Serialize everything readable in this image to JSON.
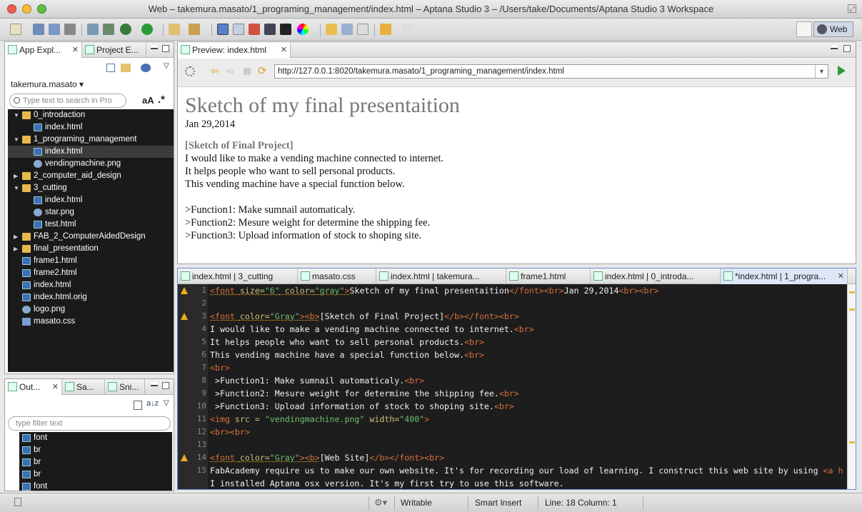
{
  "window": {
    "title": "Web – takemura.masato/1_programing_management/index.html – Aptana Studio 3 – /Users/take/Documents/Aptana Studio 3 Workspace"
  },
  "toolbar": {
    "perspective_label": "Web"
  },
  "explorer": {
    "tabs": [
      {
        "label": "App Expl..."
      },
      {
        "label": "Project E..."
      }
    ],
    "project": "takemura.masato ▾",
    "search_placeholder": "Type text to search in Pro",
    "case_label": "aA",
    "regex_label": ".*",
    "tree": [
      {
        "label": "0_introdaction",
        "kind": "folder",
        "expanded": true
      },
      {
        "label": "index.html",
        "kind": "html"
      },
      {
        "label": "1_programing_management",
        "kind": "folder",
        "expanded": true
      },
      {
        "label": "index.html",
        "kind": "html",
        "selected": true
      },
      {
        "label": "vendingmachine.png",
        "kind": "png"
      },
      {
        "label": "2_computer_aid_design",
        "kind": "folder",
        "expanded": false
      },
      {
        "label": "3_cutting",
        "kind": "folder",
        "expanded": true
      },
      {
        "label": "index.html",
        "kind": "html"
      },
      {
        "label": "star.png",
        "kind": "png"
      },
      {
        "label": "test.html",
        "kind": "html"
      },
      {
        "label": "FAB_2_ComputerAidedDesign",
        "kind": "folder",
        "expanded": false
      },
      {
        "label": "final_presentation",
        "kind": "folder",
        "expanded": false
      },
      {
        "label": "frame1.html",
        "kind": "html"
      },
      {
        "label": "frame2.html",
        "kind": "html"
      },
      {
        "label": "index.html",
        "kind": "html"
      },
      {
        "label": "index.html.orig",
        "kind": "html"
      },
      {
        "label": "logo.png",
        "kind": "png"
      },
      {
        "label": "masato.css",
        "kind": "css"
      }
    ]
  },
  "outline": {
    "tabs": [
      {
        "label": "Out..."
      },
      {
        "label": "Sa..."
      },
      {
        "label": "Sni..."
      }
    ],
    "filter_placeholder": "type filter text",
    "items": [
      "font",
      "br",
      "br",
      "br",
      "font"
    ]
  },
  "preview": {
    "tab_label": "Preview: index.html",
    "url": "http://127.0.0.1:8020/takemura.masato/1_programing_management/index.html",
    "heading": "Sketch of my final presentaition",
    "date": "Jan 29,2014",
    "section_title": "[Sketch of Final Project]",
    "lines": [
      "I would like to make a vending machine connected to internet.",
      "It helps people who want to sell personal products.",
      "This vending machine have a special function below."
    ],
    "functions": [
      ">Function1: Make sumnail automaticaly.",
      ">Function2: Mesure weight for determine the shipping fee.",
      ">Function3: Upload information of stock to shoping site."
    ]
  },
  "editor": {
    "tabs": [
      {
        "label": "index.html | 3_cutting"
      },
      {
        "label": "masato.css"
      },
      {
        "label": "index.html | takemura..."
      },
      {
        "label": "frame1.html"
      },
      {
        "label": "index.html | 0_introda..."
      },
      {
        "label": "*index.html | 1_progra..."
      }
    ],
    "line_numbers": [
      "1",
      "2",
      "3",
      "4",
      "5",
      "6",
      "7",
      "8",
      "9",
      "10",
      "11",
      "12",
      "13",
      "14",
      "15"
    ]
  },
  "status": {
    "mode": "Writable",
    "insert": "Smart Insert",
    "position": "Line: 18 Column: 1"
  },
  "colors": {
    "accent": "#6b8ad2",
    "editor_bg": "#1d1d1d",
    "tag": "#d8703a",
    "string": "#6cbf6c"
  }
}
